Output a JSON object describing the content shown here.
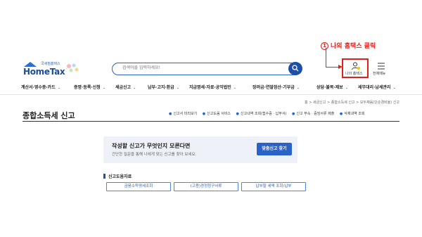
{
  "annotation": {
    "number": "1",
    "text": "나의 홈택스 클릭"
  },
  "header": {
    "logo_sub": "국세청홈택스",
    "logo_text": "HomeTax",
    "search_placeholder": "검색어를 입력하세요!",
    "myhome_label": "나의 홈택스",
    "allmenu_label": "전체메뉴"
  },
  "gnb": {
    "items": [
      {
        "label": "계산서·영수증·카드",
        "chev": "⌄"
      },
      {
        "label": "증명·등록·신청",
        "chev": "⌄"
      },
      {
        "label": "세금신고",
        "chev": "⌄"
      },
      {
        "label": "납부·고지·환급",
        "chev": "⌄"
      },
      {
        "label": "지급명세·자료·공익법인",
        "chev": "⌄"
      },
      {
        "label": "장려금·연말정산·기부금",
        "chev": "⌄"
      },
      {
        "label": "상담·불복·제보",
        "chev": "⌄"
      },
      {
        "label": "세무대리·납세관리",
        "chev": "⌄"
      }
    ]
  },
  "breadcrumb": "홈 > 세금신고 > 종합소득세 신고 > 모두채움(단순경비율) 신고",
  "page": {
    "title": "종합소득세 신고",
    "quick_links": [
      "신고서 미리보기",
      "신고도움 서비스",
      "신고내역 조회(접수증 · 납부서)",
      "신고 부속 · 증빙서류 제출",
      "삭제내역 조회"
    ]
  },
  "guide": {
    "heading": "작성할 신고가 무엇인지 모른다면",
    "sub": "간단한 질문을 통해 나에게 맞는 신고를 찾아 보세요.",
    "button": "맞춤신고 찾기"
  },
  "resources": {
    "title": "신고도움자료",
    "buttons": [
      "금융소득명세조회",
      "(고용)경정청구서류",
      "납부할 세액 조회/납부"
    ]
  },
  "colors": {
    "accent": "#2a63c7",
    "annotation": "#e0201a",
    "guide_bg": "#eef2f8"
  }
}
